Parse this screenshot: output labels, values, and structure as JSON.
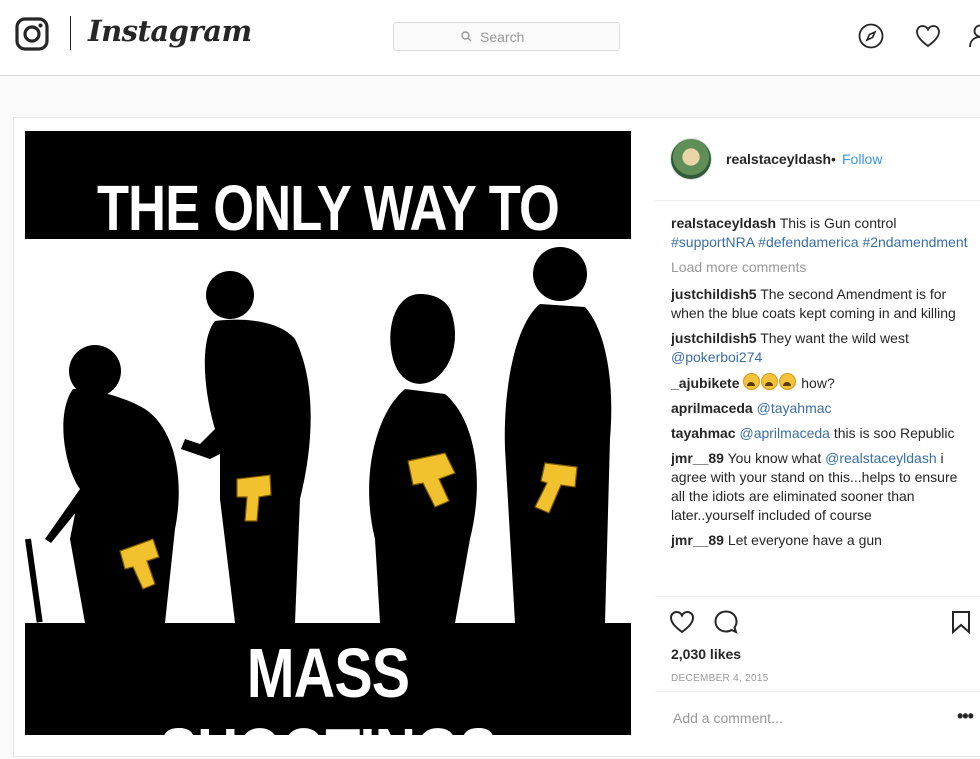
{
  "nav": {
    "wordmark": "Instagram",
    "search_placeholder": "Search",
    "icons": [
      "instagram-glyph-icon",
      "search-icon",
      "compass-icon",
      "heart-icon",
      "profile-icon"
    ]
  },
  "post_image": {
    "top_text": "THE ONLY WAY TO STOP",
    "bottom_text": "MASS SHOOTINGS"
  },
  "header": {
    "username": "realstaceyldash",
    "separator": "•",
    "follow_label": "Follow"
  },
  "caption": {
    "username": "realstaceyldash",
    "text": "This is Gun control",
    "hashtags": "#supportNRA #defendamerica #2ndamendment"
  },
  "load_more": "Load more comments",
  "comments": [
    {
      "user": "justchildish5",
      "text": "The second Amendment is for when the blue coats kept coming in and killing"
    },
    {
      "user": "justchildish5",
      "text": "They want the wild west",
      "mention": "@pokerboi274"
    },
    {
      "user": "_ajubikete",
      "text": "how?"
    },
    {
      "user": "aprilmaceda",
      "mention": "@tayahmac"
    },
    {
      "user": "tayahmac",
      "mention": "@aprilmaceda",
      "text": "this is soo Republic"
    },
    {
      "user": "jmr__89",
      "text_before": "You know what",
      "mention": "@realstaceyldash",
      "text_after": "i agree with your stand on this...helps to ensure all the idiots are eliminated sooner than later..yourself included of course"
    },
    {
      "user": "jmr__89",
      "text": "Let everyone have a gun"
    }
  ],
  "likes": "2,030 likes",
  "date": "DECEMBER 4, 2015",
  "add_comment_placeholder": "Add a comment...",
  "more_options": "•••",
  "colors": {
    "link_blue": "#3897f0",
    "hashtag_blue": "#3a6ea5",
    "gun_yellow": "#f2c12e",
    "muted": "#999999"
  }
}
